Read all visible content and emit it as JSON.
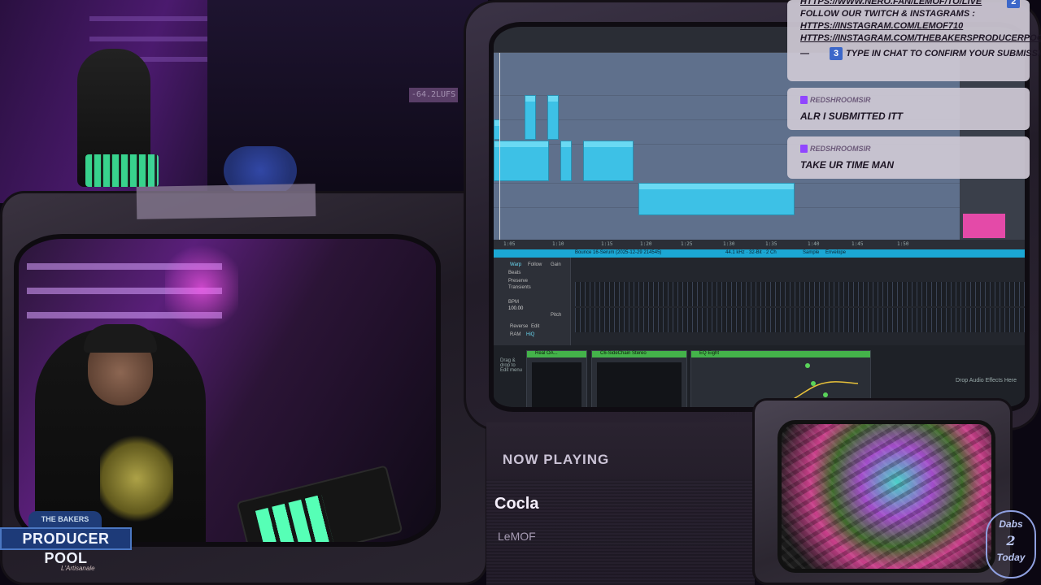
{
  "meter": {
    "lufs": "-64.2LUFS"
  },
  "brand": {
    "top": "THE BAKERS",
    "main": "PRODUCER POOL",
    "sig": "L'Artisanale"
  },
  "daw": {
    "timebar": [
      "1:05",
      "1:10",
      "1:15",
      "1:20",
      "1:25",
      "1:30",
      "1:35",
      "1:40",
      "1:45",
      "1:50"
    ],
    "clip_header": "Bounce 16-Serum (2025-12-29 214545)",
    "clip_info": "44.1 kHz · 32-Bit · 2 Ch",
    "tab_sample": "Sample",
    "tab_envelope": "Envelope",
    "warp": "Warp",
    "follow": "Follow",
    "beats": "Beats",
    "preserve": "Preserve",
    "transients": "Transients",
    "bpm_label": "BPM",
    "bpm": "100.00",
    "reverse": "Reverse",
    "edit": "Edit",
    "ram": "RAM",
    "hiq": "HiQ",
    "gain_label": "Gain",
    "pitch_label": "Pitch",
    "drag_hint": "Drag & drop to Edit menu",
    "device_1": "Real OA...",
    "device_2": "C6-SideChain Stereo",
    "device_3": "EQ Eight",
    "drop_note": "Drop Audio Effects Here",
    "tracks": [
      "4 Reverb",
      "B Delay",
      "Main"
    ]
  },
  "chat": {
    "pinned": {
      "line0": "HTTPS://WWW.NERO.FAN/LEMOF/TO/LIVE",
      "line0_badge": "2",
      "line1": "FOLLOW OUR TWITCH & INSTAGRAMS :",
      "line2": "HTTPS://INSTAGRAM.COM/LEMOF710",
      "line3": "HTTPS://INSTAGRAM.COM/THEBAKERSPRODUCERPOOL",
      "line4_dash": "—",
      "line4_badge": "3",
      "line4": "TYPE IN CHAT TO CONFIRM YOUR SUBMISSION"
    },
    "messages": [
      {
        "user": "REDSHROOMSIR",
        "text": "ALR I SUBMITTED ITT"
      },
      {
        "user": "REDSHROOMSIR",
        "text": "TAKE UR TIME MAN"
      }
    ]
  },
  "now_playing": {
    "label": "NOW PLAYING",
    "title": "Cocla",
    "artist": "LeMOF"
  },
  "badge": {
    "top": "Dabs",
    "middle": "2",
    "bottom": "Today"
  },
  "colors": {
    "accent": "#3dc1e6",
    "chat_bg": "#cdc8d4",
    "twitch": "#9146ff",
    "badge_blue": "#3c67c9"
  }
}
